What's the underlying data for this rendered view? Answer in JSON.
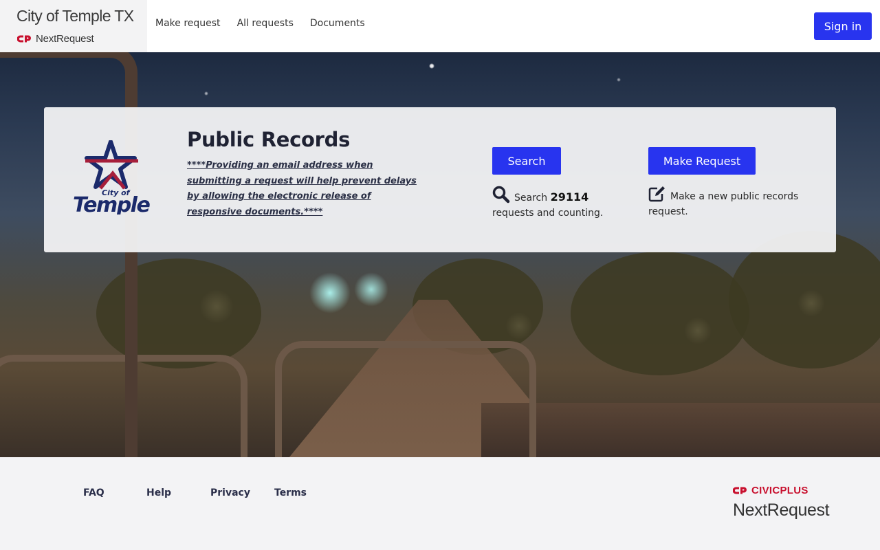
{
  "header": {
    "site_title": "City of Temple TX",
    "product_name": "NextRequest",
    "nav": [
      {
        "label": "Make request"
      },
      {
        "label": "All requests"
      },
      {
        "label": "Documents"
      }
    ],
    "sign_in_label": "Sign in"
  },
  "hero": {
    "logo_text_small": "City of",
    "logo_text_large": "Temple",
    "title": "Public Records",
    "note": "****Providing an email address when submitting a request will help prevent delays by allowing the electronic release of responsive documents.****",
    "search": {
      "button_label": "Search",
      "prefix": "Search",
      "count": "29114",
      "suffix": "requests and counting.",
      "icon": "search-icon"
    },
    "make_request": {
      "button_label": "Make Request",
      "description": "Make a new public records request.",
      "icon": "edit-icon"
    }
  },
  "footer": {
    "links": [
      {
        "label": "FAQ"
      },
      {
        "label": "Help"
      },
      {
        "label": "Privacy"
      },
      {
        "label": "Terms"
      }
    ],
    "vendor": "CIVICPLUS",
    "vendor_product": "NextRequest"
  },
  "colors": {
    "accent": "#2834ef",
    "brand_red": "#c8102e",
    "logo_navy": "#1b2a6b"
  }
}
